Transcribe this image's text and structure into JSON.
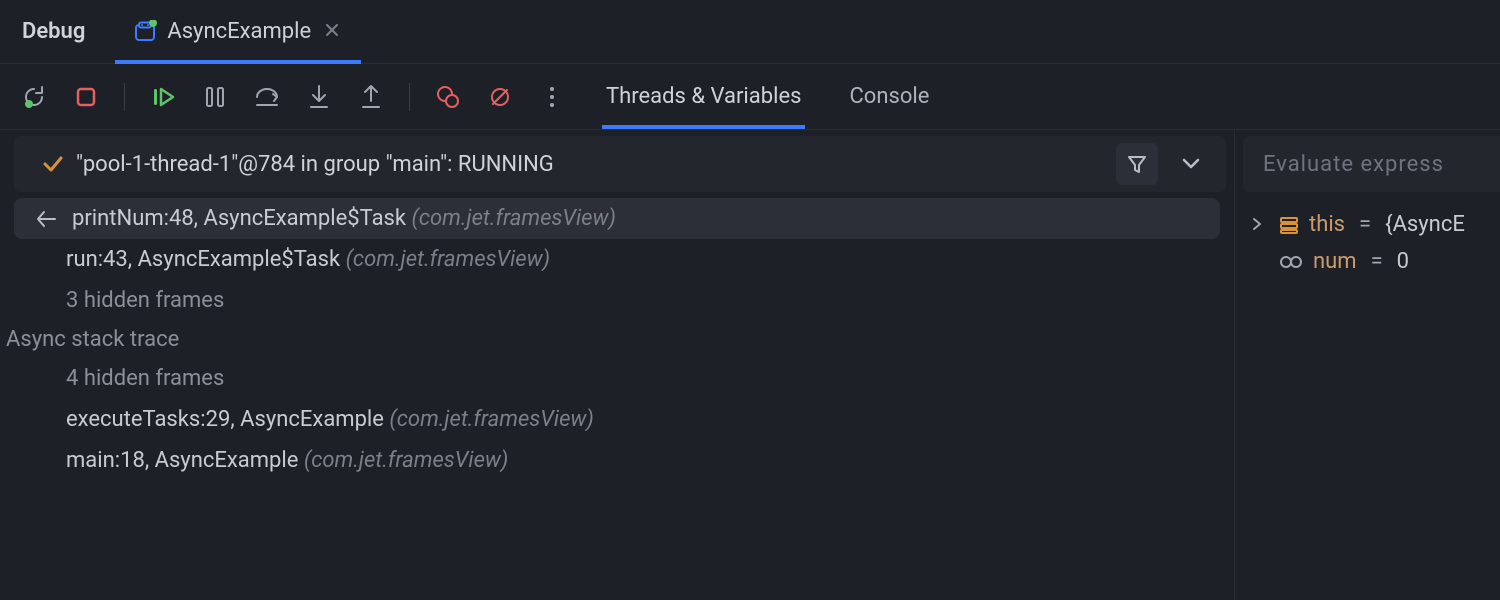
{
  "header": {
    "title": "Debug",
    "active_tab": {
      "label": "AsyncExample",
      "icon_color": "#3a7bff",
      "dot_color": "#5ec46a"
    }
  },
  "toolbar": {
    "rerun": "rerun",
    "stop": "stop",
    "resume": "resume",
    "pause": "pause",
    "step_over": "step-over",
    "step_into": "step-into",
    "step_out": "step-out",
    "breakpoints": "view-breakpoints",
    "mute": "mute-breakpoints",
    "more": "more"
  },
  "subtabs": {
    "threads_vars": "Threads & Variables",
    "console": "Console"
  },
  "thread": {
    "text": "\"pool-1-thread-1\"@784 in group \"main\": RUNNING"
  },
  "frames": {
    "selected": {
      "main": "printNum:48, AsyncExample$Task",
      "pkg": "(com.jet.framesView)"
    },
    "f1": {
      "main": "run:43, AsyncExample$Task",
      "pkg": "(com.jet.framesView)"
    },
    "hidden_top": "3 hidden frames",
    "async_label": "Async stack trace",
    "hidden_async": "4 hidden frames",
    "f2": {
      "main": "executeTasks:29, AsyncExample",
      "pkg": "(com.jet.framesView)"
    },
    "f3": {
      "main": "main:18, AsyncExample",
      "pkg": "(com.jet.framesView)"
    }
  },
  "vars": {
    "eval_placeholder": "Evaluate express",
    "this": {
      "name": "this",
      "val": "{AsyncE"
    },
    "num": {
      "name": "num",
      "val": "0"
    }
  }
}
